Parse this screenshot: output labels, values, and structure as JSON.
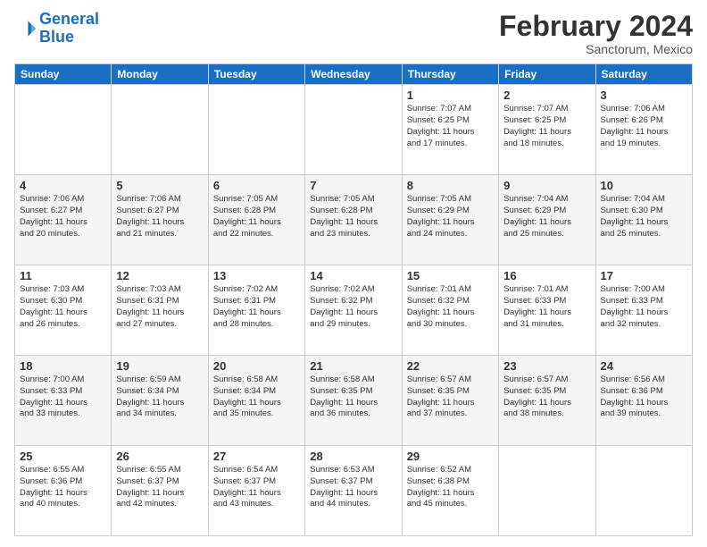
{
  "logo": {
    "line1": "General",
    "line2": "Blue"
  },
  "title": "February 2024",
  "subtitle": "Sanctorum, Mexico",
  "headers": [
    "Sunday",
    "Monday",
    "Tuesday",
    "Wednesday",
    "Thursday",
    "Friday",
    "Saturday"
  ],
  "weeks": [
    [
      {
        "day": "",
        "info": ""
      },
      {
        "day": "",
        "info": ""
      },
      {
        "day": "",
        "info": ""
      },
      {
        "day": "",
        "info": ""
      },
      {
        "day": "1",
        "info": "Sunrise: 7:07 AM\nSunset: 6:25 PM\nDaylight: 11 hours\nand 17 minutes."
      },
      {
        "day": "2",
        "info": "Sunrise: 7:07 AM\nSunset: 6:25 PM\nDaylight: 11 hours\nand 18 minutes."
      },
      {
        "day": "3",
        "info": "Sunrise: 7:06 AM\nSunset: 6:26 PM\nDaylight: 11 hours\nand 19 minutes."
      }
    ],
    [
      {
        "day": "4",
        "info": "Sunrise: 7:06 AM\nSunset: 6:27 PM\nDaylight: 11 hours\nand 20 minutes."
      },
      {
        "day": "5",
        "info": "Sunrise: 7:06 AM\nSunset: 6:27 PM\nDaylight: 11 hours\nand 21 minutes."
      },
      {
        "day": "6",
        "info": "Sunrise: 7:05 AM\nSunset: 6:28 PM\nDaylight: 11 hours\nand 22 minutes."
      },
      {
        "day": "7",
        "info": "Sunrise: 7:05 AM\nSunset: 6:28 PM\nDaylight: 11 hours\nand 23 minutes."
      },
      {
        "day": "8",
        "info": "Sunrise: 7:05 AM\nSunset: 6:29 PM\nDaylight: 11 hours\nand 24 minutes."
      },
      {
        "day": "9",
        "info": "Sunrise: 7:04 AM\nSunset: 6:29 PM\nDaylight: 11 hours\nand 25 minutes."
      },
      {
        "day": "10",
        "info": "Sunrise: 7:04 AM\nSunset: 6:30 PM\nDaylight: 11 hours\nand 25 minutes."
      }
    ],
    [
      {
        "day": "11",
        "info": "Sunrise: 7:03 AM\nSunset: 6:30 PM\nDaylight: 11 hours\nand 26 minutes."
      },
      {
        "day": "12",
        "info": "Sunrise: 7:03 AM\nSunset: 6:31 PM\nDaylight: 11 hours\nand 27 minutes."
      },
      {
        "day": "13",
        "info": "Sunrise: 7:02 AM\nSunset: 6:31 PM\nDaylight: 11 hours\nand 28 minutes."
      },
      {
        "day": "14",
        "info": "Sunrise: 7:02 AM\nSunset: 6:32 PM\nDaylight: 11 hours\nand 29 minutes."
      },
      {
        "day": "15",
        "info": "Sunrise: 7:01 AM\nSunset: 6:32 PM\nDaylight: 11 hours\nand 30 minutes."
      },
      {
        "day": "16",
        "info": "Sunrise: 7:01 AM\nSunset: 6:33 PM\nDaylight: 11 hours\nand 31 minutes."
      },
      {
        "day": "17",
        "info": "Sunrise: 7:00 AM\nSunset: 6:33 PM\nDaylight: 11 hours\nand 32 minutes."
      }
    ],
    [
      {
        "day": "18",
        "info": "Sunrise: 7:00 AM\nSunset: 6:33 PM\nDaylight: 11 hours\nand 33 minutes."
      },
      {
        "day": "19",
        "info": "Sunrise: 6:59 AM\nSunset: 6:34 PM\nDaylight: 11 hours\nand 34 minutes."
      },
      {
        "day": "20",
        "info": "Sunrise: 6:58 AM\nSunset: 6:34 PM\nDaylight: 11 hours\nand 35 minutes."
      },
      {
        "day": "21",
        "info": "Sunrise: 6:58 AM\nSunset: 6:35 PM\nDaylight: 11 hours\nand 36 minutes."
      },
      {
        "day": "22",
        "info": "Sunrise: 6:57 AM\nSunset: 6:35 PM\nDaylight: 11 hours\nand 37 minutes."
      },
      {
        "day": "23",
        "info": "Sunrise: 6:57 AM\nSunset: 6:35 PM\nDaylight: 11 hours\nand 38 minutes."
      },
      {
        "day": "24",
        "info": "Sunrise: 6:56 AM\nSunset: 6:36 PM\nDaylight: 11 hours\nand 39 minutes."
      }
    ],
    [
      {
        "day": "25",
        "info": "Sunrise: 6:55 AM\nSunset: 6:36 PM\nDaylight: 11 hours\nand 40 minutes."
      },
      {
        "day": "26",
        "info": "Sunrise: 6:55 AM\nSunset: 6:37 PM\nDaylight: 11 hours\nand 42 minutes."
      },
      {
        "day": "27",
        "info": "Sunrise: 6:54 AM\nSunset: 6:37 PM\nDaylight: 11 hours\nand 43 minutes."
      },
      {
        "day": "28",
        "info": "Sunrise: 6:53 AM\nSunset: 6:37 PM\nDaylight: 11 hours\nand 44 minutes."
      },
      {
        "day": "29",
        "info": "Sunrise: 6:52 AM\nSunset: 6:38 PM\nDaylight: 11 hours\nand 45 minutes."
      },
      {
        "day": "",
        "info": ""
      },
      {
        "day": "",
        "info": ""
      }
    ]
  ]
}
